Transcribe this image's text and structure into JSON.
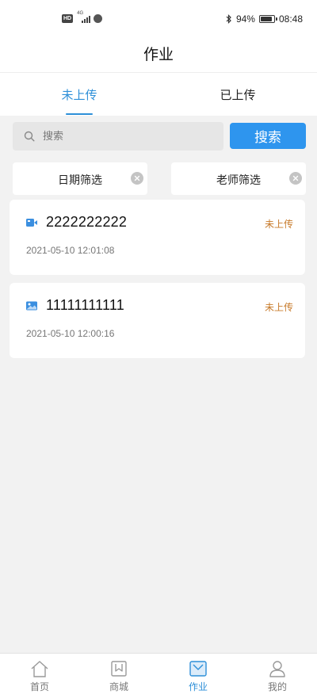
{
  "status_bar": {
    "hd_label": "HD",
    "signal_label": "4G",
    "battery_percent": "94%",
    "battery_level": 0.94,
    "time": "08:48"
  },
  "header": {
    "title": "作业"
  },
  "tabs": [
    {
      "label": "未上传",
      "active": true
    },
    {
      "label": "已上传",
      "active": false
    }
  ],
  "search": {
    "placeholder": "搜索",
    "value": "",
    "button_label": "搜索"
  },
  "filters": {
    "date_label": "日期筛选",
    "teacher_label": "老师筛选"
  },
  "homework_list": [
    {
      "icon": "video-icon",
      "title": "2222222222",
      "status": "未上传",
      "date": "2021-05-10 12:01:08"
    },
    {
      "icon": "image-icon",
      "title": "11111111111",
      "status": "未上传",
      "date": "2021-05-10 12:00:16"
    }
  ],
  "bottom_nav": [
    {
      "label": "首页",
      "icon": "home-icon",
      "active": false
    },
    {
      "label": "商城",
      "icon": "shop-icon",
      "active": false
    },
    {
      "label": "作业",
      "icon": "homework-icon",
      "active": true
    },
    {
      "label": "我的",
      "icon": "profile-icon",
      "active": false
    }
  ],
  "colors": {
    "accent": "#2d8fd8",
    "button": "#2e95ee",
    "status_pending": "#c77a2a",
    "background": "#f2f2f2"
  }
}
